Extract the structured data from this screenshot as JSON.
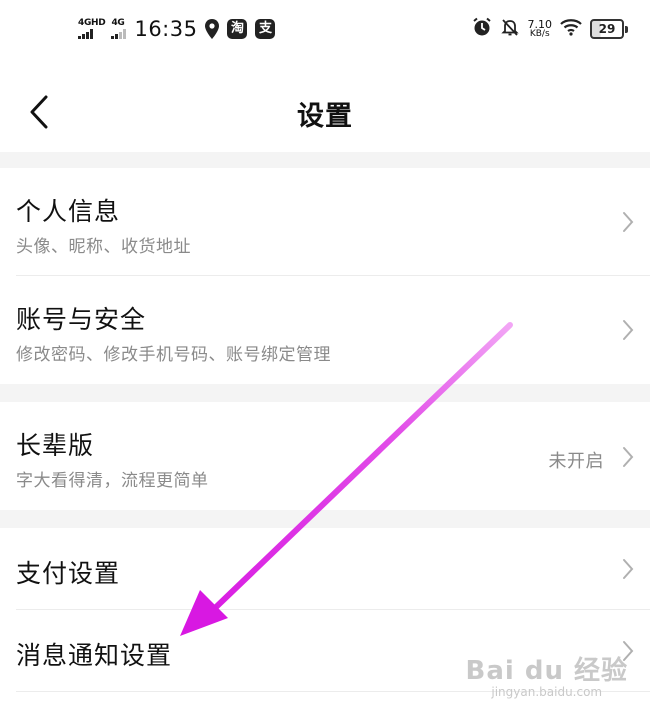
{
  "status_bar": {
    "network_1": "4GHD",
    "network_2": "4G",
    "time": "16:35",
    "app_badge_1": "淘",
    "app_badge_2": "支",
    "speed_value": "7.10",
    "speed_unit": "KB/s",
    "battery_level": "29",
    "icons": [
      "location-icon",
      "alarm-icon",
      "notification-off-icon",
      "wifi-icon",
      "battery-icon"
    ]
  },
  "header": {
    "back_icon": "back-arrow-icon",
    "title": "设置"
  },
  "settings": {
    "personal_info": {
      "title": "个人信息",
      "subtitle": "头像、昵称、收货地址"
    },
    "account_security": {
      "title": "账号与安全",
      "subtitle": "修改密码、修改手机号码、账号绑定管理"
    },
    "elder_mode": {
      "title": "长辈版",
      "subtitle": "字大看得清，流程更简单",
      "value": "未开启"
    },
    "payment": {
      "title": "支付设置"
    },
    "notifications": {
      "title": "消息通知设置"
    }
  },
  "annotation": {
    "arrow_color": "#e11ee8"
  },
  "watermark": {
    "main": "Bai du 经验",
    "sub": "jingyan.baidu.com"
  },
  "colors": {
    "divider": "#f4f4f4",
    "subtitle": "#8a8a8a",
    "chevron": "#b0b0b0"
  }
}
